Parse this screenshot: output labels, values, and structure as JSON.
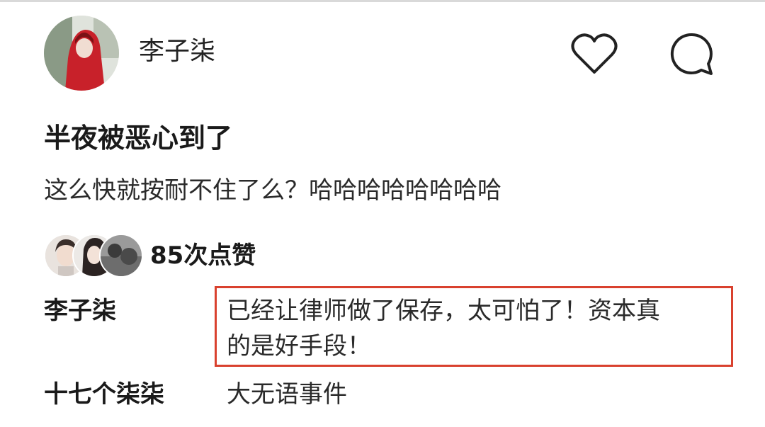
{
  "header": {
    "username": "李子柒",
    "avatar_icon": "user-avatar",
    "like_icon": "heart-icon",
    "comment_icon": "comment-bubble-icon"
  },
  "post": {
    "title": "半夜被恶心到了",
    "body": "这么快就按耐不住了么？哈哈哈哈哈哈哈哈"
  },
  "likes": {
    "count_text": "85次点赞"
  },
  "comments": [
    {
      "author": "李子柒",
      "text_line1": "已经让律师做了保存，太可怕了！资本真",
      "text_line2": "的是好手段！"
    },
    {
      "author": "十七个柒柒",
      "text_line1": "大无语事件"
    }
  ],
  "colors": {
    "highlight_border": "#d9412e",
    "avatar_red": "#c8212a"
  }
}
